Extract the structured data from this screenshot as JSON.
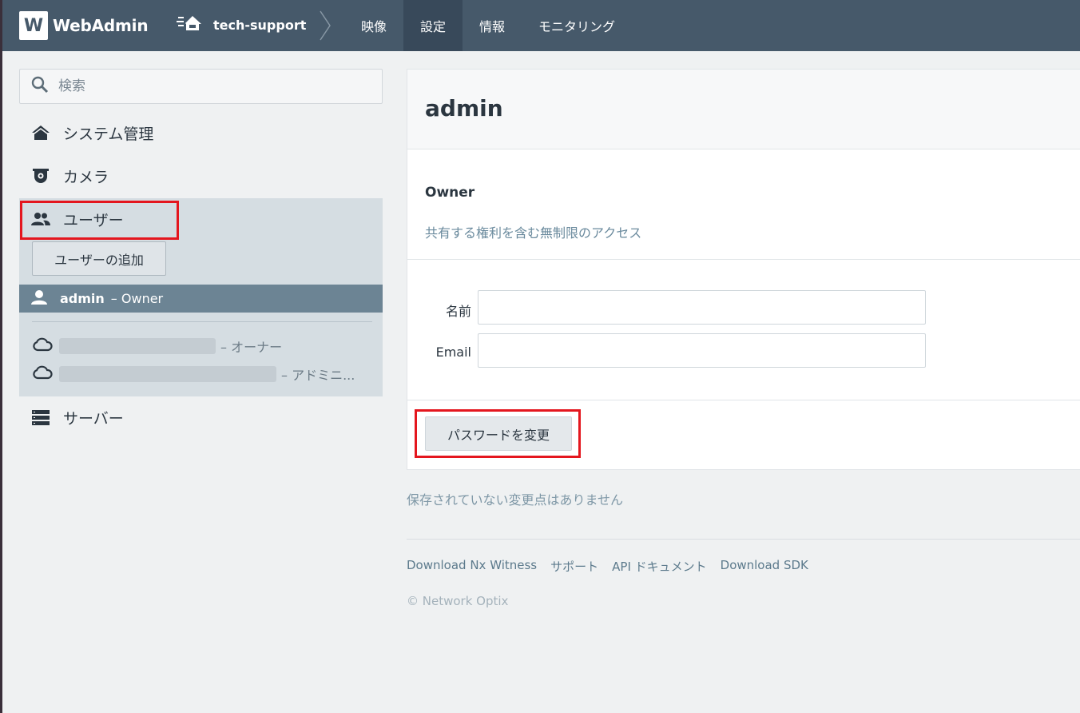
{
  "header": {
    "logo_letter": "W",
    "app_title": "WebAdmin",
    "system_name": "tech-support",
    "nav": [
      {
        "label": "映像",
        "active": false
      },
      {
        "label": "設定",
        "active": true
      },
      {
        "label": "情報",
        "active": false
      },
      {
        "label": "モニタリング",
        "active": false
      }
    ]
  },
  "sidebar": {
    "search_placeholder": "検索",
    "items": {
      "system": "システム管理",
      "camera": "カメラ",
      "users": "ユーザー",
      "server": "サーバー"
    },
    "add_user_label": "ユーザーの追加",
    "selected_user": {
      "name": "admin",
      "role": "– Owner"
    },
    "cloud_users": [
      {
        "role": "– オーナー"
      },
      {
        "role": "– アドミニ..."
      }
    ]
  },
  "main": {
    "title": "admin",
    "role_title": "Owner",
    "role_desc": "共有する権利を含む無制限のアクセス",
    "name_label": "名前",
    "email_label": "Email",
    "name_value": "",
    "email_value": "",
    "change_password_label": "パスワードを変更",
    "status": "保存されていない変更点はありません"
  },
  "footer": {
    "links": [
      "Download Nx Witness",
      "サポート",
      "API ドキュメント",
      "Download SDK"
    ],
    "copyright": "© Network Optix"
  },
  "colors": {
    "topbar": "#46596a",
    "highlight": "#e4161e",
    "selected_row": "#6c8494"
  }
}
